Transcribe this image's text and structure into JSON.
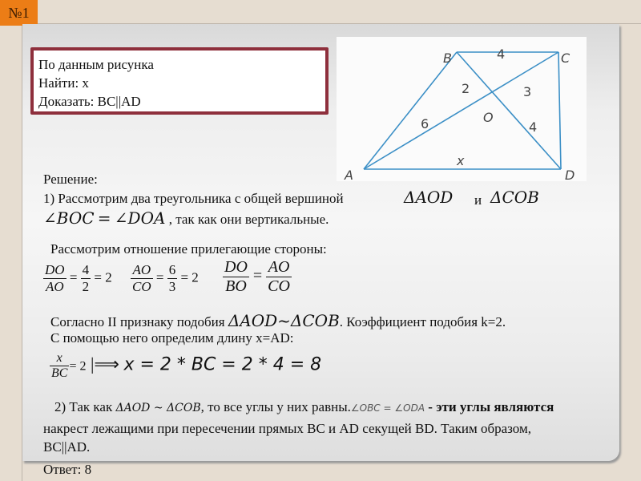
{
  "slide_number": "№1",
  "task": {
    "line1": "По данным рисунка",
    "line2": "Найти: x",
    "line3": "Доказать: BC||AD"
  },
  "figure": {
    "points": {
      "A": "A",
      "B": "B",
      "C": "C",
      "D": "D",
      "O": "O"
    },
    "labels": {
      "BC": "4",
      "BO": "2",
      "CO": "3",
      "AO": "6",
      "DO": "4",
      "AD": "x"
    },
    "line_color": "#3b8fc6"
  },
  "solution": {
    "heading": "Решение:",
    "step1_text": "1) Рассмотрим два треугольника с общей вершиной",
    "step1_tri1": "ΔAOD",
    "step1_and": "и",
    "step1_tri2": "ΔCOB",
    "step1_angle1": "∠BOC",
    "step1_eq": "=",
    "step1_angle2": "∠DOA",
    "step1_reason": ", так как они вертикальные.",
    "ratio_intro": "Рассмотрим отношение прилегающие стороны:",
    "ratio1": {
      "num": "DO",
      "den": "AO",
      "eq": "=",
      "vnum": "4",
      "vden": "2",
      "result": "= 2"
    },
    "ratio2": {
      "num": "AO",
      "den": "CO",
      "eq": "=",
      "vnum": "6",
      "vden": "3",
      "result": "= 2"
    },
    "ratio3": {
      "num1": "DO",
      "den1": "BO",
      "eq": "=",
      "num2": "AO",
      "den2": "CO"
    },
    "similarity_text": "Согласно II признаку подобия",
    "similarity_expr": "ΔAOD~ΔCOB",
    "similarity_coef": ". Коэффициент подобия k=2.",
    "length_text": "С помощью него определим длину x=AD:",
    "formula": {
      "num": "x",
      "den": "BC",
      "eq": "= 2",
      "implies": "|⟹",
      "rest": "x = 2 * BC = 2 * 4 = 8"
    },
    "step2_a": "2) Так как",
    "step2_expr": "ΔAOD ~ ΔCOB",
    "step2_b": ", то все углы у них равны.",
    "step2_angles": "∠OBC = ∠ODA",
    "step2_c": "- эти углы являются",
    "step2_line2": "накрест лежащими при пересечении прямых BC и AD секущей BD. Таким образом,",
    "step2_line3": "BC||AD.",
    "answer": "Ответ: 8"
  },
  "colors": {
    "badge": "#ec7d16",
    "task_border": "#8e2f3c",
    "background": "#e6ddd1"
  }
}
